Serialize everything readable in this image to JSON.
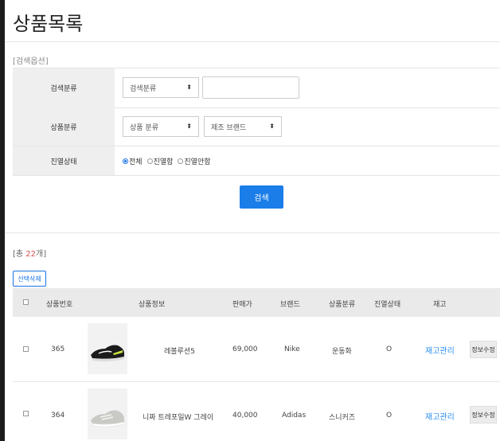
{
  "page": {
    "title": "상품목록",
    "search_options_label": "[검색옵션]"
  },
  "search": {
    "rows": [
      {
        "label": "검색분류",
        "select": "검색분류"
      },
      {
        "label": "상품분류",
        "select": "상품 분류",
        "select2": "제조 브랜드"
      },
      {
        "label": "진열상태"
      }
    ],
    "radios": [
      "전체",
      "진열함",
      "진열안함"
    ],
    "selected_radio": "전체",
    "button": "검색"
  },
  "list": {
    "count_prefix": "[총 ",
    "count": "22",
    "count_suffix": "개]",
    "delete_button": "선택삭제",
    "headers": [
      "상품번호",
      "상품정보",
      "판매가",
      "브랜드",
      "상품분류",
      "진열상태",
      "재고"
    ],
    "rows": [
      {
        "id": "365",
        "name": "레볼루션5",
        "price": "69,000",
        "brand": "Nike",
        "category": "운동화",
        "display": "O",
        "stock": "재고관리",
        "edit": "정보수정"
      },
      {
        "id": "364",
        "name": "니짜 트레포일W 그레이",
        "price": "40,000",
        "brand": "Adidas",
        "category": "스니커즈",
        "display": "O",
        "stock": "재고관리",
        "edit": "정보수정"
      }
    ]
  },
  "colors": {
    "accent": "#1a7de8",
    "link": "#2b8ff0",
    "count": "#d9534f",
    "header_bg": "#eaeaea"
  }
}
